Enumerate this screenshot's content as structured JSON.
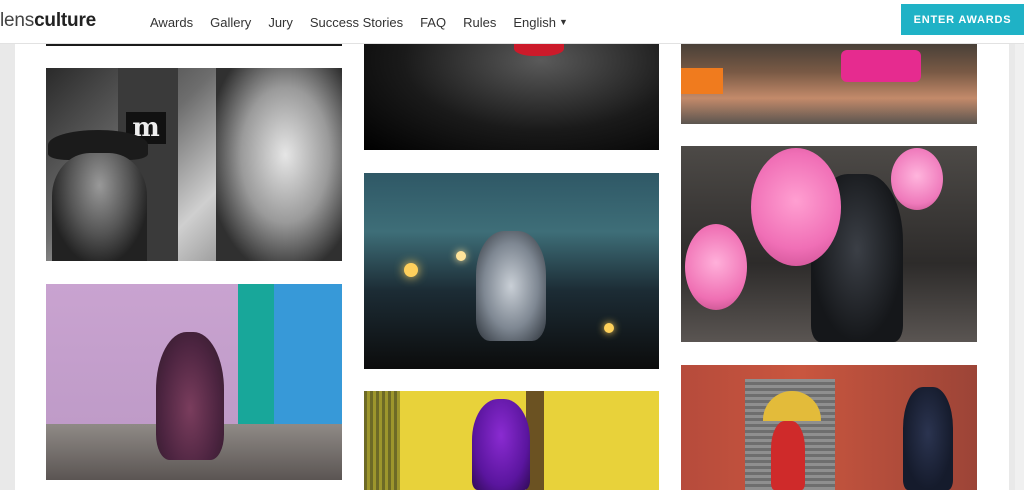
{
  "header": {
    "logo_prefix": "lens",
    "logo_suffix": "culture",
    "nav": [
      "Awards",
      "Gallery",
      "Jury",
      "Success Stories",
      "FAQ",
      "Rules"
    ],
    "language": "English",
    "cta": "ENTER AWARDS"
  },
  "gallery": {
    "columns": 3
  },
  "colors": {
    "accent": "#1fb2c6",
    "background": "#e9e9e9",
    "page": "#ffffff"
  }
}
